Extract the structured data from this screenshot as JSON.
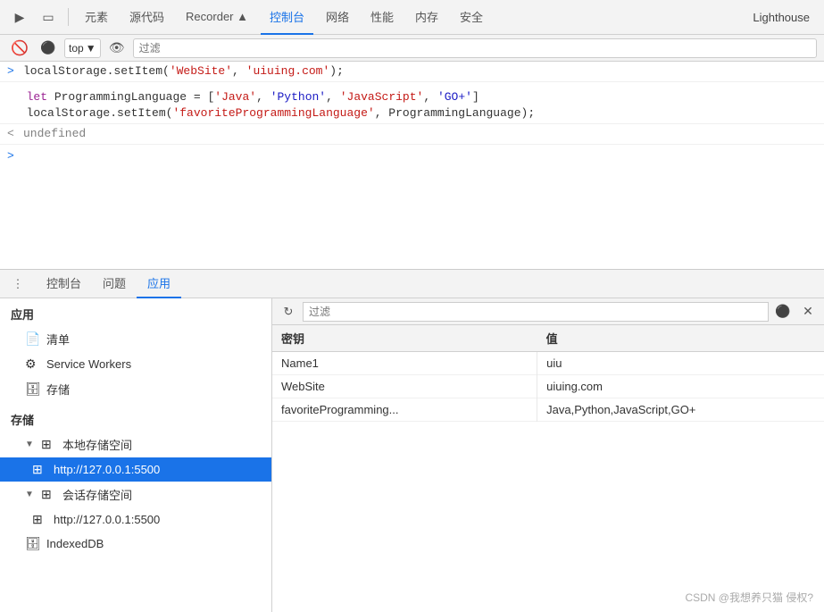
{
  "topToolbar": {
    "navItems": [
      {
        "label": "元素",
        "active": false
      },
      {
        "label": "源代码",
        "active": false
      },
      {
        "label": "Recorder ▲",
        "active": false
      },
      {
        "label": "控制台",
        "active": true
      },
      {
        "label": "网络",
        "active": false
      },
      {
        "label": "性能",
        "active": false
      },
      {
        "label": "内存",
        "active": false
      },
      {
        "label": "安全",
        "active": false
      }
    ],
    "lighthouse": "Lighthouse"
  },
  "consoleToolbar": {
    "topSelectorLabel": "top",
    "filterPlaceholder": "过滤"
  },
  "consoleOutput": {
    "lines": [
      {
        "type": "input",
        "content": "localStorage.setItem('WebSite', 'uiuing.com');"
      },
      {
        "type": "blank"
      },
      {
        "type": "input-multi",
        "lines": [
          "let ProgrammingLanguage = ['Java', 'Python', 'JavaScript', 'GO+']",
          "localStorage.setItem('favoriteProgrammingLanguage', ProgrammingLanguage);"
        ]
      },
      {
        "type": "result",
        "content": "undefined"
      }
    ],
    "promptArrow": ">"
  },
  "bottomTabs": {
    "dots": "⋮",
    "items": [
      {
        "label": "控制台",
        "active": false
      },
      {
        "label": "问题",
        "active": false
      },
      {
        "label": "应用",
        "active": true
      }
    ]
  },
  "sidebar": {
    "appSection": "应用",
    "items": [
      {
        "label": "清单",
        "icon": "📄",
        "indent": 1
      },
      {
        "label": "Service Workers",
        "icon": "⚙",
        "indent": 1
      },
      {
        "label": "存储",
        "icon": "🗄",
        "indent": 1
      }
    ],
    "storageSection": "存储",
    "storageItems": [
      {
        "label": "本地存储空间",
        "icon": "⊞",
        "indent": 1,
        "expanded": true,
        "arrow": "▼"
      },
      {
        "label": "http://127.0.0.1:5500",
        "icon": "⊞",
        "indent": 2,
        "active": true
      },
      {
        "label": "会话存储空间",
        "icon": "⊞",
        "indent": 1,
        "expanded": true,
        "arrow": "▼"
      },
      {
        "label": "http://127.0.0.1:5500",
        "icon": "⊞",
        "indent": 2,
        "active": false
      },
      {
        "label": "IndexedDB",
        "icon": "🗄",
        "indent": 1
      }
    ]
  },
  "mainPanel": {
    "filterPlaceholder": "过滤",
    "tableHeaders": [
      "密钥",
      "值"
    ],
    "rows": [
      {
        "key": "Name1",
        "value": "uiu"
      },
      {
        "key": "WebSite",
        "value": "uiuing.com"
      },
      {
        "key": "favoriteProgramming...",
        "value": "Java,Python,JavaScript,GO+"
      }
    ]
  },
  "watermark": "CSDN @我想养只猫 侵权?"
}
